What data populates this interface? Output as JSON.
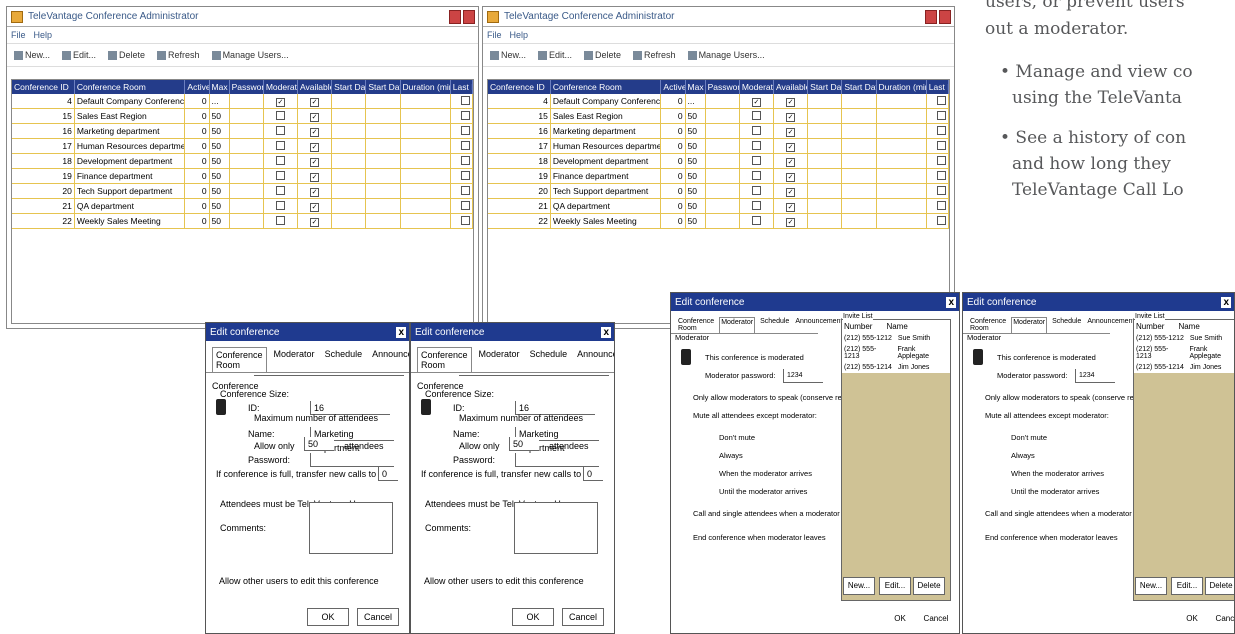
{
  "right_text": {
    "line1": "users, or prevent users",
    "line2": "out a moderator.",
    "bullet1a": "• Manage and view co",
    "bullet1b": "using the TeleVanta",
    "bullet2a": "• See a history of con",
    "bullet2b": "and how long they",
    "bullet2c": "TeleVantage Call Lo"
  },
  "admin": {
    "title": "TeleVantage Conference Administrator",
    "menu": [
      "File",
      "Help"
    ],
    "toolbar": [
      "New...",
      "Edit...",
      "Delete",
      "Refresh",
      "Manage Users..."
    ],
    "columns": [
      "Conference ID",
      "Conference Room",
      "Active",
      "Max",
      "Password",
      "Moderated",
      "Available",
      "Start Date",
      "Start Date",
      "Duration (mins)",
      "Last Di"
    ],
    "rows": [
      {
        "id": "4",
        "room": "Default Company Conference",
        "active": "0",
        "max": "...",
        "mod": true,
        "avail": true
      },
      {
        "id": "15",
        "room": "Sales East Region",
        "active": "0",
        "max": "50",
        "mod": false,
        "avail": true
      },
      {
        "id": "16",
        "room": "Marketing department",
        "active": "0",
        "max": "50",
        "mod": false,
        "avail": true
      },
      {
        "id": "17",
        "room": "Human Resources department",
        "active": "0",
        "max": "50",
        "mod": false,
        "avail": true
      },
      {
        "id": "18",
        "room": "Development department",
        "active": "0",
        "max": "50",
        "mod": false,
        "avail": true
      },
      {
        "id": "19",
        "room": "Finance department",
        "active": "0",
        "max": "50",
        "mod": false,
        "avail": true
      },
      {
        "id": "20",
        "room": "Tech Support department",
        "active": "0",
        "max": "50",
        "mod": false,
        "avail": true
      },
      {
        "id": "21",
        "room": "QA department",
        "active": "0",
        "max": "50",
        "mod": false,
        "avail": true
      },
      {
        "id": "22",
        "room": "Weekly Sales Meeting",
        "active": "0",
        "max": "50",
        "mod": false,
        "avail": true
      }
    ]
  },
  "edit_dialog": {
    "title": "Edit conference",
    "close": "x",
    "tabs": [
      "Conference Room",
      "Moderator",
      "Schedule",
      "Announcements"
    ],
    "section": "Conference",
    "id_label": "ID:",
    "id_value": "16",
    "name_label": "Name:",
    "name_value": "Marketing department",
    "password_label": "Password:",
    "size_label": "Conference Size:",
    "max_label": "Maximum number of attendees",
    "allow_label": "Allow only",
    "allow_value": "50",
    "attendees": "attendees",
    "transfer_label": "If conference is full, transfer new calls to ext:",
    "transfer_value": "0",
    "tv_users_label": "Attendees must be TeleVantage Users",
    "comments_label": "Comments:",
    "allow_edit_label": "Allow other users to edit this conference",
    "ok": "OK",
    "cancel": "Cancel"
  },
  "mod_dialog": {
    "title": "Edit conference",
    "close": "x",
    "tabs": [
      "Conference Room",
      "Moderator",
      "Schedule",
      "Announcements"
    ],
    "section": "Moderator",
    "moderated_label": "This conference is moderated",
    "password_label": "Moderator password:",
    "password_value": "1234",
    "only_speak_label": "Only allow moderators to speak (conserve resources)",
    "mute_label": "Mute all attendees except moderator:",
    "opt_dont": "Don't mute",
    "opt_always": "Always",
    "opt_arrives": "When the moderator arrives",
    "opt_until": "Until the moderator arrives",
    "call_end_label": "Call and single attendees when a moderator joins",
    "end_conf_label": "End conference when moderator leaves",
    "invite_label": "Invite List",
    "col_number": "Number",
    "col_name": "Name",
    "list": [
      {
        "number": "(212) 555-1212",
        "name": "Sue Smith"
      },
      {
        "number": "(212) 555-1213",
        "name": "Frank Applegate"
      },
      {
        "number": "(212) 555-1214",
        "name": "Jim Jones"
      }
    ],
    "new": "New...",
    "edit": "Edit...",
    "delete": "Delete",
    "ok": "OK",
    "cancel": "Cancel"
  }
}
